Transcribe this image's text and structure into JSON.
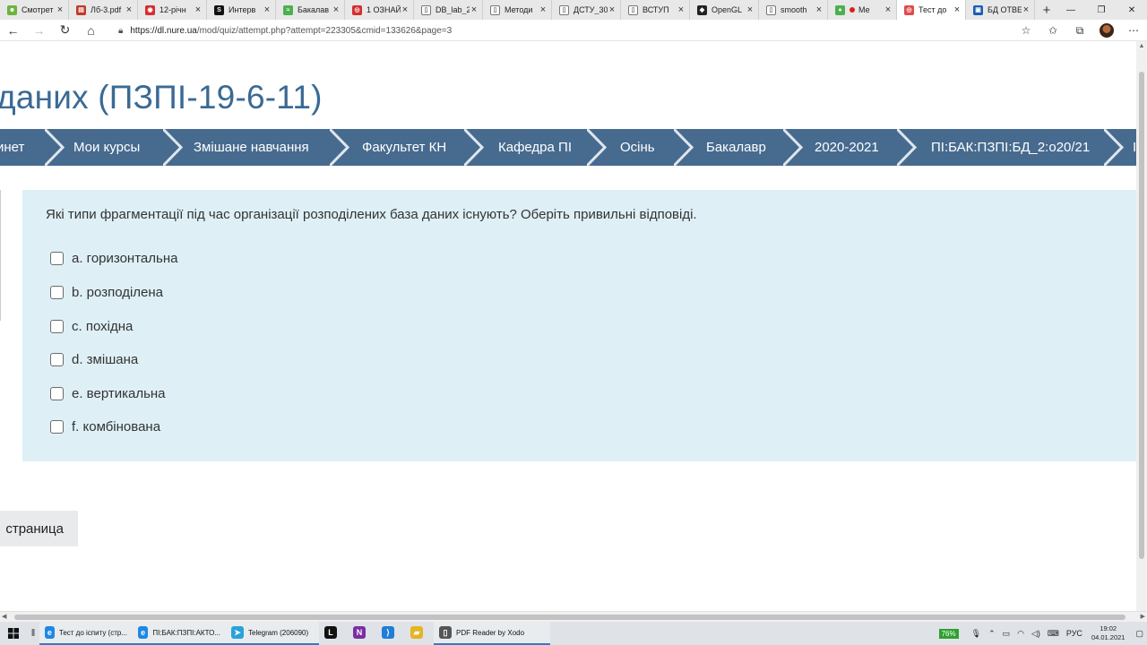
{
  "browser": {
    "tabs": [
      {
        "title": "Смотрет",
        "color": "#6db33f",
        "glyph": "☻"
      },
      {
        "title": "Лб-3.pdf",
        "color": "#c0392b",
        "glyph": "▤"
      },
      {
        "title": "12-річн",
        "color": "#d32f2f",
        "glyph": "◉"
      },
      {
        "title": "Интерв",
        "color": "#111111",
        "glyph": "S"
      },
      {
        "title": "Бакалав",
        "color": "#4caf50",
        "glyph": "≈"
      },
      {
        "title": "1 ОЗНАЙ",
        "color": "#d32f2f",
        "glyph": "◎"
      },
      {
        "title": "DB_lab_2",
        "color": "#ffffff",
        "glyph": "▯"
      },
      {
        "title": "Методи",
        "color": "#ffffff",
        "glyph": "▯"
      },
      {
        "title": "ДСТУ_30",
        "color": "#ffffff",
        "glyph": "▯"
      },
      {
        "title": "ВСТУП",
        "color": "#ffffff",
        "glyph": "▯"
      },
      {
        "title": "OpenGL",
        "color": "#222222",
        "glyph": "◆"
      },
      {
        "title": "smooth",
        "color": "#ffffff",
        "glyph": "▯"
      },
      {
        "title": "Ме",
        "color": "#4caf50",
        "glyph": "●"
      },
      {
        "title": "Тест до",
        "color": "#e04b4b",
        "glyph": "◎"
      },
      {
        "title": "БД ОТВЕ",
        "color": "#1a5fb4",
        "glyph": "▣"
      }
    ],
    "active_tab_index": 13,
    "url_host": "https://dl.nure.ua",
    "url_path": "/mod/quiz/attempt.php?attempt=223305&cmid=133626&page=3"
  },
  "page": {
    "title": "даних (ПЗПІ-19-6-11)",
    "breadcrumb": [
      "инет",
      "Мои курсы",
      "Змішане навчання",
      "Факультет КН",
      "Кафедра ПІ",
      "Осінь",
      "Бакалавр",
      "2020-2021",
      "ПІ:БАК:ПЗПІ:БД_2:o20/21",
      "І"
    ],
    "question": "Які типи фрагментації під час організації розподілених база даних існують? Оберіть привильні відповіді.",
    "answers": [
      "a. горизонтальна",
      "b. розподілена",
      "c. похідна",
      "d. змішана",
      "e. вертикальна",
      "f. комбінована"
    ],
    "next_button": "страница"
  },
  "taskbar": {
    "apps": [
      {
        "label": "Тест до іспиту (стр...",
        "color": "#1e88e5",
        "glyph": "e",
        "open": true
      },
      {
        "label": "ПІ:БАК:ПЗПІ:АКТО...",
        "color": "#1e88e5",
        "glyph": "e",
        "open": true
      },
      {
        "label": "Telegram (206090)",
        "color": "#2aa1da",
        "glyph": "➤",
        "open": true
      },
      {
        "label": "",
        "color": "#111111",
        "glyph": "L",
        "open": false
      },
      {
        "label": "",
        "color": "#7b2fa3",
        "glyph": "N",
        "open": false
      },
      {
        "label": "",
        "color": "#1f7ed6",
        "glyph": "⟩",
        "open": false
      },
      {
        "label": "",
        "color": "#e6b325",
        "glyph": "▰",
        "open": false
      },
      {
        "label": "PDF Reader by Xodo",
        "color": "#555555",
        "glyph": "▯",
        "open": true
      }
    ],
    "battery": "76%",
    "lang": "РУС",
    "time": "19:02",
    "date": "04.01.2021"
  }
}
